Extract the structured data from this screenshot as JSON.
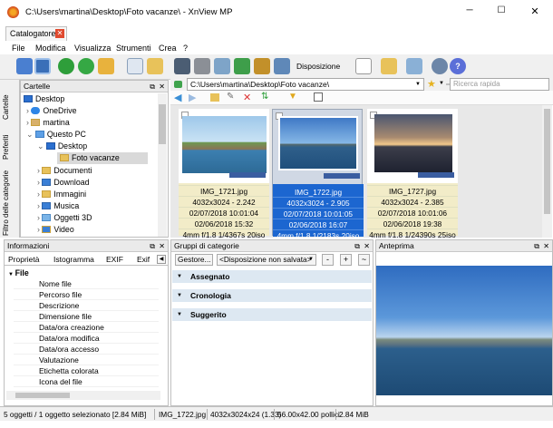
{
  "window": {
    "title": "C:\\Users\\martina\\Desktop\\Foto vacanze\\ - XnView MP"
  },
  "tab": {
    "label": "Catalogatore"
  },
  "menu": [
    "File",
    "Modifica",
    "Visualizza",
    "Strumenti",
    "Crea",
    "?"
  ],
  "toolbar": {
    "layout_label": "Disposizione"
  },
  "folders": {
    "title": "Cartelle",
    "side_tabs": [
      "Cartelle",
      "Preferiti",
      "Filtro delle categorie"
    ],
    "items": [
      "Desktop",
      "OneDrive",
      "martina",
      "Questo PC",
      "Desktop",
      "Foto vacanze",
      "Documenti",
      "Download",
      "Immagini",
      "Musica",
      "Oggetti 3D",
      "Video"
    ]
  },
  "browser": {
    "path": "C:\\Users\\martina\\Desktop\\Foto vacanze\\",
    "search_placeholder": "Ricerca rapida",
    "thumbs": [
      {
        "name": "IMG_1721.jpg",
        "info": [
          "4032x3024 - 2.242",
          "02/07/2018 10:01:04",
          "02/06/2018 15:32",
          "4mm f/1.8 1/4367s 20iso"
        ],
        "selected": false
      },
      {
        "name": "IMG_1722.jpg",
        "info": [
          "4032x3024 - 2.905",
          "02/07/2018 10:01:05",
          "02/06/2018 16:07",
          "4mm f/1.8 1/2183s 20iso"
        ],
        "selected": true
      },
      {
        "name": "IMG_1727.jpg",
        "info": [
          "4032x3024 - 2.385",
          "02/07/2018 10:01:06",
          "02/06/2018 19:38",
          "4mm f/1.8 1/24390s 25iso"
        ],
        "selected": false
      }
    ]
  },
  "info": {
    "title": "Informazioni",
    "tabs": [
      "Proprietà",
      "Istogramma",
      "EXIF",
      "Exif"
    ],
    "section": "File",
    "rows": [
      "Nome file",
      "Percorso file",
      "Descrizione",
      "Dimensione file",
      "Data/ora creazione",
      "Data/ora modifica",
      "Data/ora accesso",
      "Valutazione",
      "Etichetta colorata",
      "Icona del file"
    ]
  },
  "categories": {
    "title": "Gruppi di categorie",
    "manage_label": "Gestore...",
    "layout_value": "<Disposizione non salvata>",
    "groups": [
      "Assegnato",
      "Cronologia",
      "Suggerito"
    ]
  },
  "preview": {
    "title": "Anteprima"
  },
  "status": [
    "5 oggetti / 1 oggetto selezionato [2.84 MiB]",
    "IMG_1722.jpg",
    "4032x3024x24 (1.33)",
    "56.00x42.00 pollici",
    "2.84 MiB"
  ]
}
